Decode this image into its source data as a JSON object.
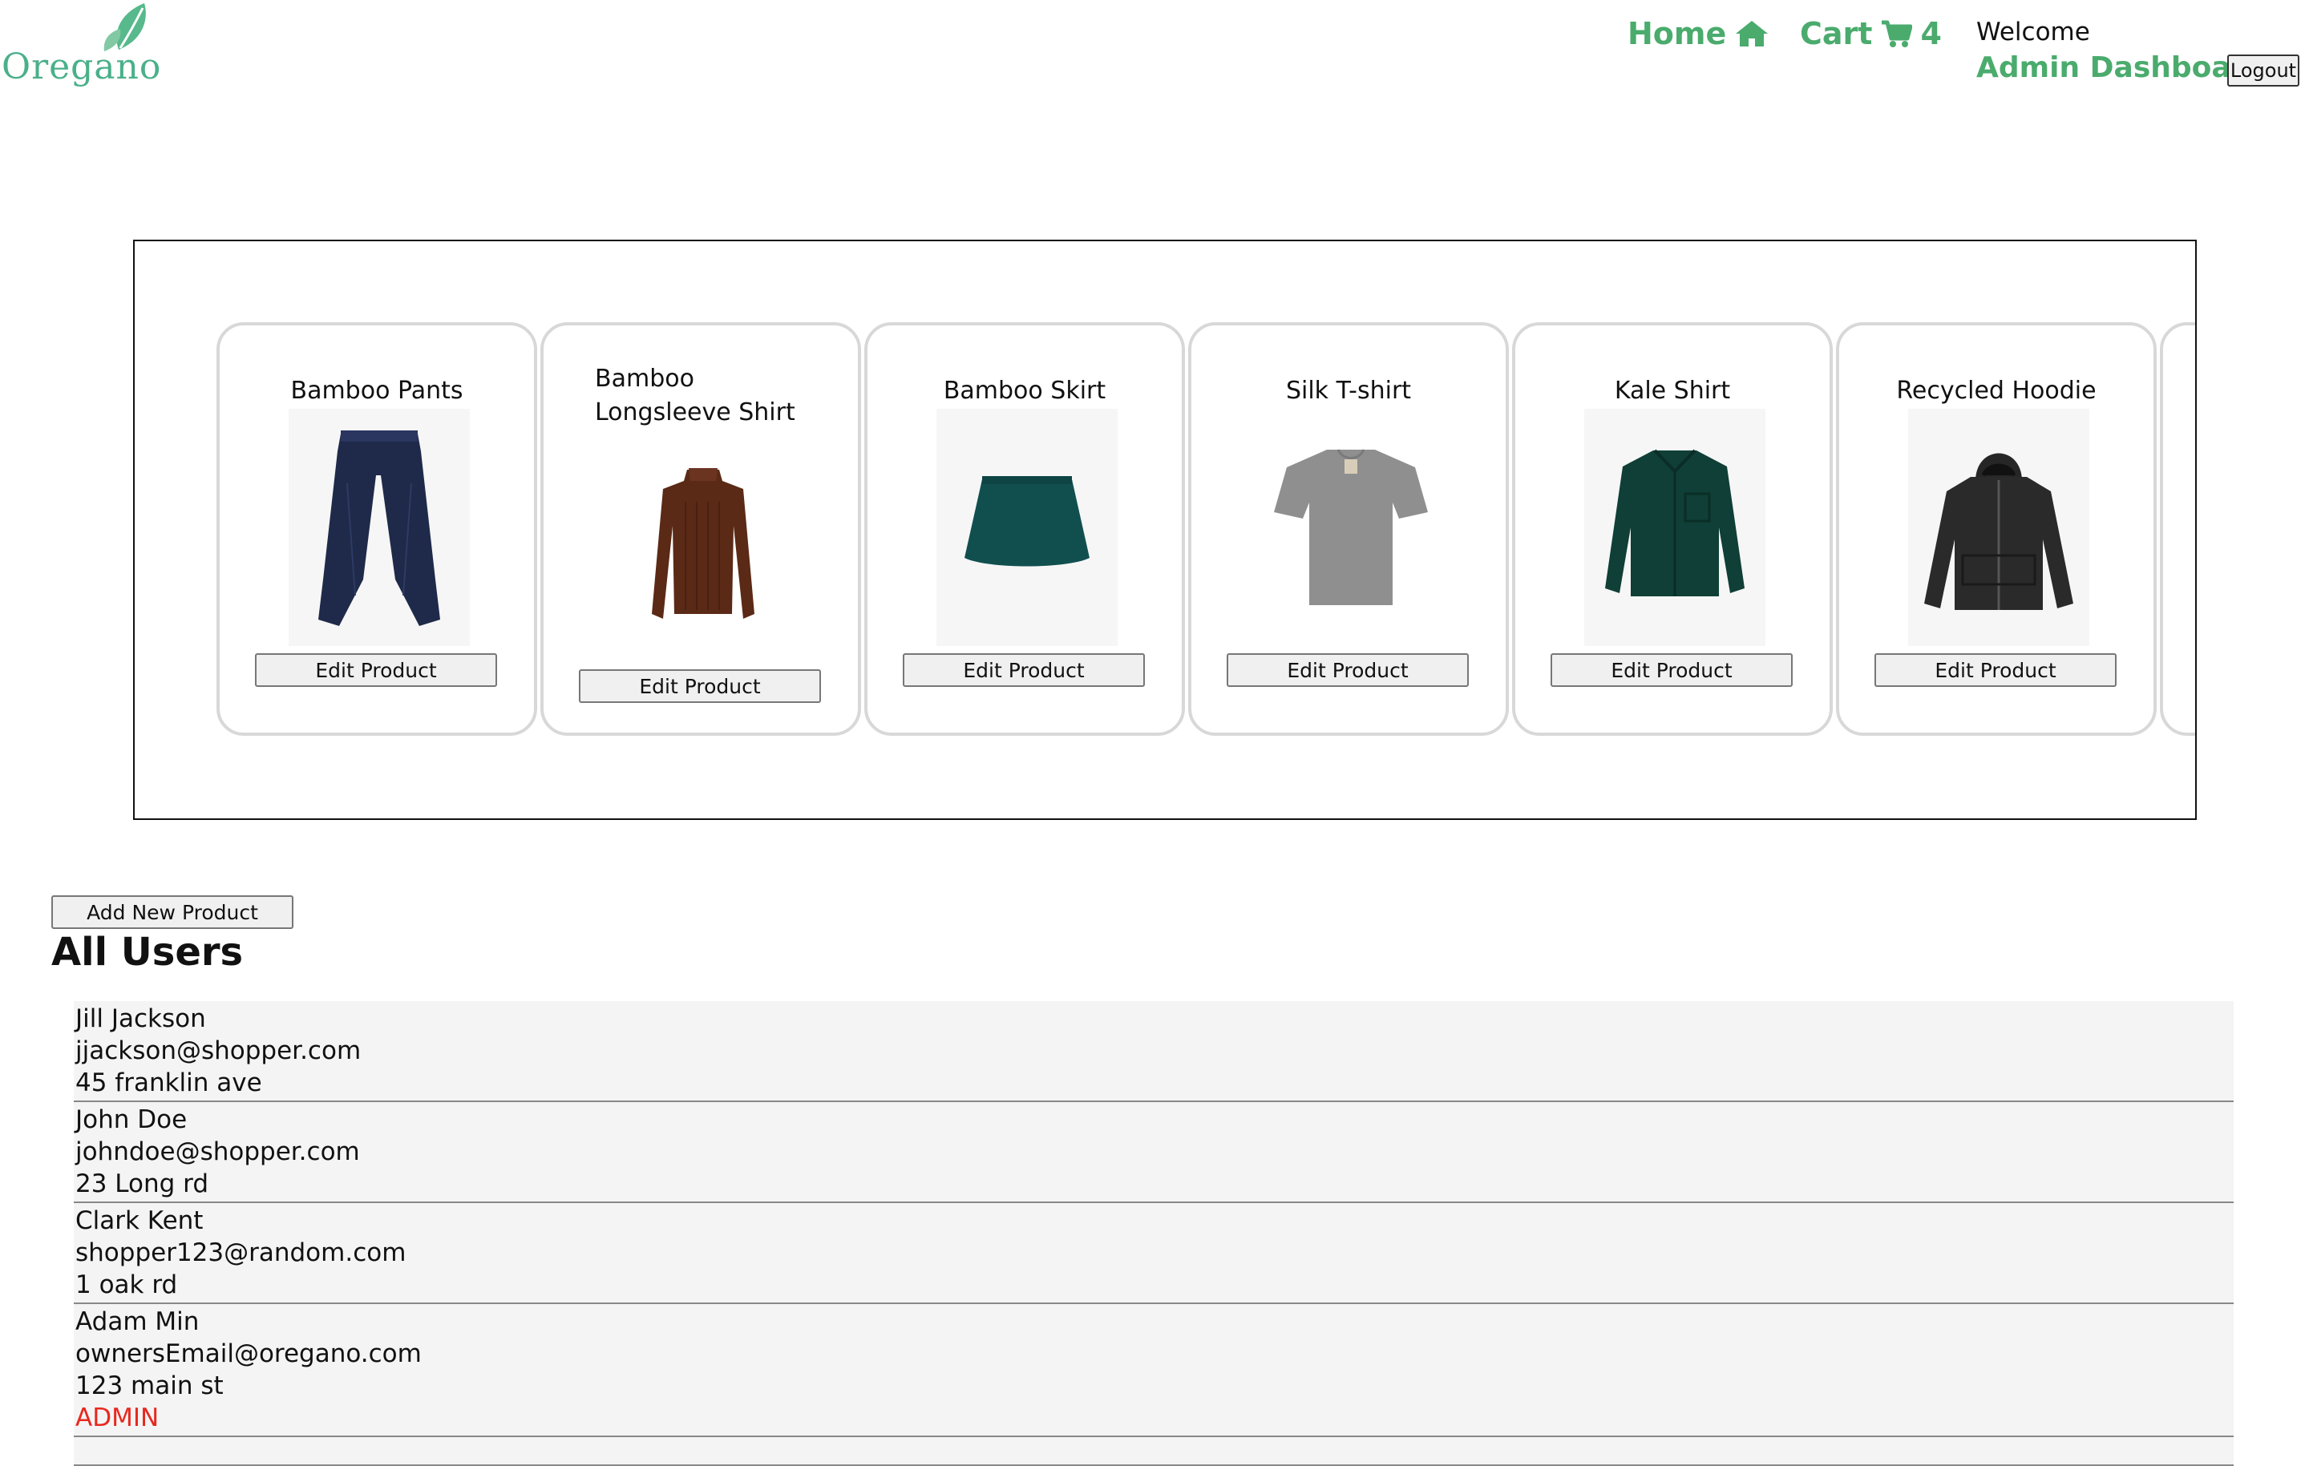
{
  "header": {
    "logo_text": "Oregano",
    "home_label": "Home",
    "cart_label": "Cart",
    "cart_count": "4",
    "welcome_text": "Welcome",
    "admin_link": "Admin Dashboard",
    "logout_label": "Logout",
    "accent_color": "#4aab6d"
  },
  "products": [
    {
      "name": "Bamboo Pants",
      "edit_label": "Edit Product",
      "image": "navy-pants"
    },
    {
      "name": "Bamboo Longsleeve Shirt",
      "edit_label": "Edit Product",
      "image": "brown-longsleeve"
    },
    {
      "name": "Bamboo Skirt",
      "edit_label": "Edit Product",
      "image": "teal-skirt"
    },
    {
      "name": "Silk T-shirt",
      "edit_label": "Edit Product",
      "image": "grey-tshirt"
    },
    {
      "name": "Kale Shirt",
      "edit_label": "Edit Product",
      "image": "green-shirt"
    },
    {
      "name": "Recycled Hoodie",
      "edit_label": "Edit Product",
      "image": "black-hoodie"
    }
  ],
  "add_product_label": "Add New Product",
  "users_title": "All Users",
  "users": [
    {
      "name": "Jill Jackson",
      "email": "jjackson@shopper.com",
      "address": "45 franklin ave",
      "role": ""
    },
    {
      "name": "John Doe",
      "email": "johndoe@shopper.com",
      "address": "23 Long rd",
      "role": ""
    },
    {
      "name": "Clark Kent",
      "email": "shopper123@random.com",
      "address": "1 oak rd",
      "role": ""
    },
    {
      "name": "Adam Min",
      "email": "ownersEmail@oregano.com",
      "address": "123 main st",
      "role": "ADMIN"
    }
  ],
  "admin_role_color": "#e8281e"
}
